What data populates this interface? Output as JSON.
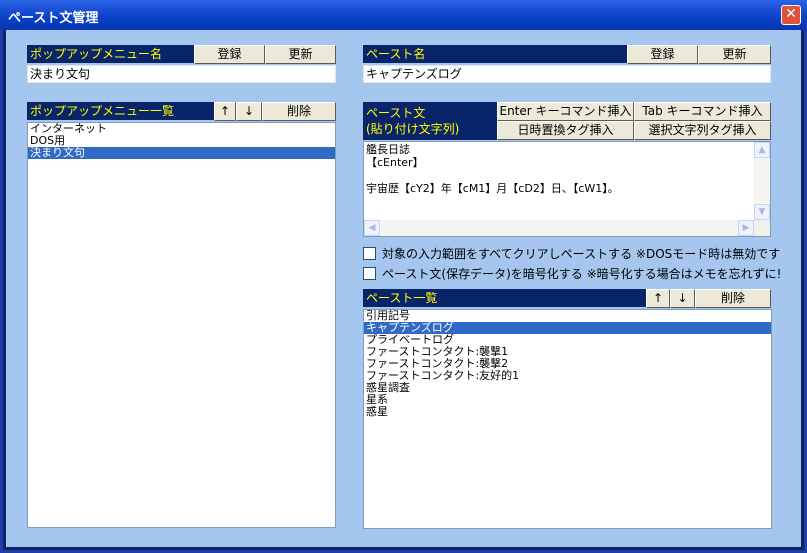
{
  "window": {
    "title": "ペースト文管理",
    "close_glyph": "✕"
  },
  "left": {
    "menu_name": {
      "header": "ポップアップメニュー名",
      "register": "登録",
      "update": "更新",
      "value": "決まり文句"
    },
    "menu_list": {
      "header": "ポップアップメニュー一覧",
      "up": "↑",
      "down": "↓",
      "delete": "削除",
      "items": [
        "インターネット",
        "DOS用",
        "決まり文句"
      ],
      "selected_index": 2
    }
  },
  "right": {
    "paste_name": {
      "header": "ペースト名",
      "register": "登録",
      "update": "更新",
      "value": "キャプテンズログ"
    },
    "paste_text": {
      "header_line1": "ペースト文",
      "header_line2": "(貼り付け文字列)",
      "enter_cmd": "Enter キーコマンド挿入",
      "tab_cmd": "Tab キーコマンド挿入",
      "datetime_tag": "日時置換タグ挿入",
      "selection_tag": "選択文字列タグ挿入",
      "lines": [
        "艦長日誌",
        "【cEnter】",
        "",
        "宇宙歴【cY2】年【cM1】月【cD2】日、【cW1】。"
      ]
    },
    "options": {
      "clear_input": "対象の入力範囲をすべてクリアしペーストする ※DOSモード時は無効です",
      "encrypt": "ペースト文(保存データ)を暗号化する ※暗号化する場合はメモを忘れずに!"
    },
    "paste_list": {
      "header": "ペースト一覧",
      "up": "↑",
      "down": "↓",
      "delete": "削除",
      "items": [
        "引用記号",
        "キャプテンズログ",
        "プライベートログ",
        "ファーストコンタクト:襲撃1",
        "ファーストコンタクト:襲撃2",
        "ファーストコンタクト:友好的1",
        "惑星調査",
        "星系",
        "惑星"
      ],
      "selected_index": 1
    }
  }
}
